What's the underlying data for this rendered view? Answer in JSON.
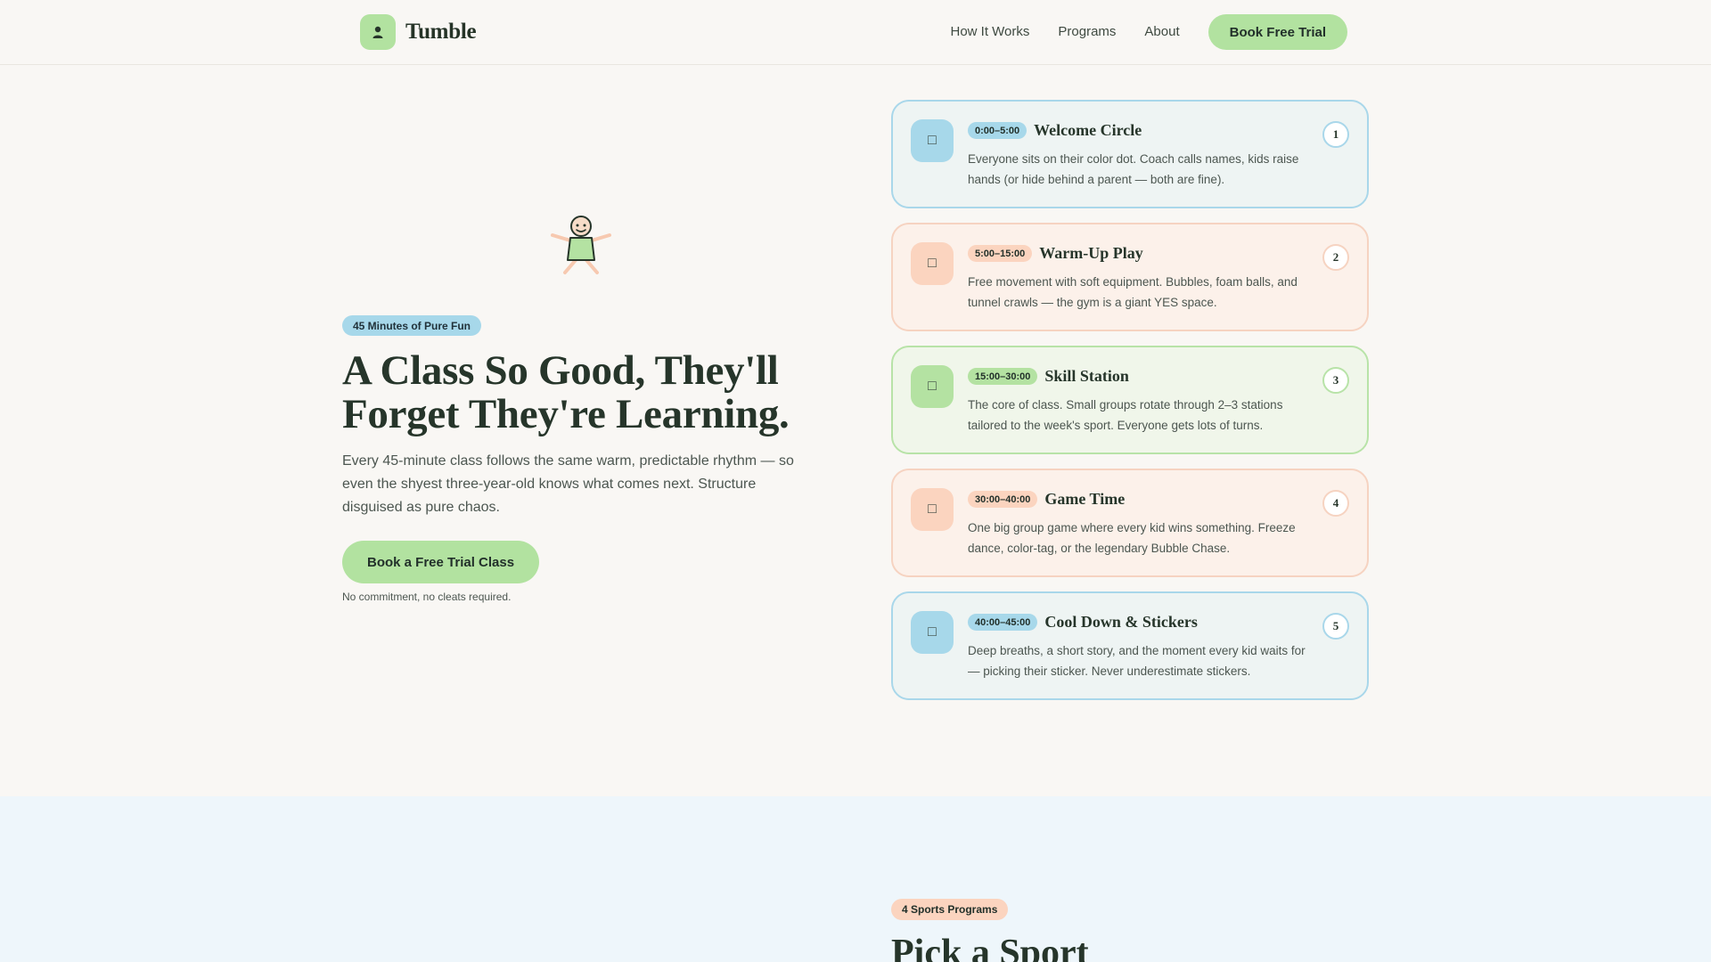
{
  "brand": {
    "name": "Tumble",
    "logo_icon": "person-icon",
    "accent": "#b2e2a0"
  },
  "nav": {
    "links": [
      "How It Works",
      "Programs",
      "About"
    ],
    "cta": "Book Free Trial"
  },
  "hero": {
    "badge": "45 Minutes of Pure Fun",
    "title_line1": "A Class So Good, They'll",
    "title_line2": "Forget They're Learning.",
    "text": "Every 45-minute class follows the same warm, predictable rhythm — so even the shyest three-year-old knows what comes next. Structure disguised as pure chaos.",
    "cta": "Book a Free Trial Class",
    "note": "No commitment, no cleats required."
  },
  "timeline": [
    {
      "num": "1",
      "time": "0:00–5:00",
      "title": "Welcome Circle",
      "desc": "Everyone sits on their color dot. Coach calls names, kids raise hands (or hide behind a parent — both are fine).",
      "color": "#a7d8ea",
      "icon": "□"
    },
    {
      "num": "2",
      "time": "5:00–15:00",
      "title": "Warm-Up Play",
      "desc": "Free movement with soft equipment. Bubbles, foam balls, and tunnel crawls — the gym is a giant YES space.",
      "color": "#fbd4bf",
      "icon": "□"
    },
    {
      "num": "3",
      "time": "15:00–30:00",
      "title": "Skill Station",
      "desc": "The core of class. Small groups rotate through 2–3 stations tailored to the week's sport. Everyone gets lots of turns.",
      "color": "#b4e2a2",
      "icon": "□"
    },
    {
      "num": "4",
      "time": "30:00–40:00",
      "title": "Game Time",
      "desc": "One big group game where every kid wins something. Freeze dance, color-tag, or the legendary Bubble Chase.",
      "color": "#fbd4bf",
      "icon": "□"
    },
    {
      "num": "5",
      "time": "40:00–45:00",
      "title": "Cool Down & Stickers",
      "desc": "Deep breaths, a short story, and the moment every kid waits for — picking their sticker. Never underestimate stickers.",
      "color": "#a7d8ea",
      "icon": "□"
    }
  ],
  "programs": {
    "badge": "4 Sports Programs",
    "title": "Pick a Sport"
  }
}
